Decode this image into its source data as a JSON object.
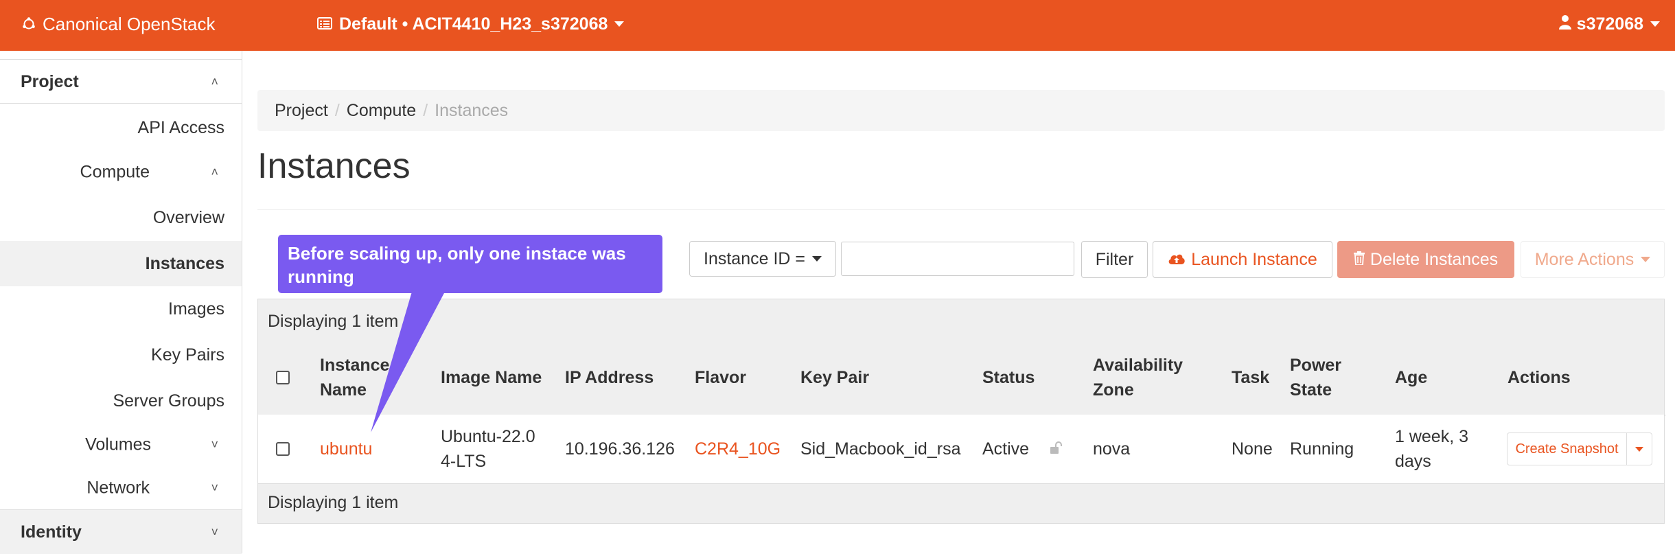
{
  "header": {
    "brand": "Canonical OpenStack",
    "project_selector": "Default • ACIT4410_H23_s372068",
    "user": "s372068",
    "accent": "#E95420"
  },
  "sidebar": {
    "project": "Project",
    "api_access": "API Access",
    "compute": "Compute",
    "overview": "Overview",
    "instances": "Instances",
    "images": "Images",
    "key_pairs": "Key Pairs",
    "server_groups": "Server Groups",
    "volumes": "Volumes",
    "network": "Network",
    "identity": "Identity"
  },
  "breadcrumb": [
    "Project",
    "Compute",
    "Instances"
  ],
  "page_title": "Instances",
  "toolbar": {
    "filter_field": "Instance ID =",
    "filter_value": "",
    "filter_button": "Filter",
    "launch_button": "Launch Instance",
    "delete_button": "Delete Instances",
    "more_button": "More Actions"
  },
  "table": {
    "display_count_text": "Displaying 1 item",
    "columns": {
      "instance_name": "Instance Name",
      "image_name": "Image Name",
      "ip_address": "IP Address",
      "flavor": "Flavor",
      "key_pair": "Key Pair",
      "status": "Status",
      "availability_zone": "Availability Zone",
      "task": "Task",
      "power_state": "Power State",
      "age": "Age",
      "actions": "Actions"
    },
    "rows": [
      {
        "instance_name": "ubuntu",
        "image_name": "Ubuntu-22.0 4-LTS",
        "ip_address": "10.196.36.126",
        "flavor": "C2R4_10G",
        "key_pair": "Sid_Macbook_id_rsa",
        "status": "Active",
        "availability_zone": "nova",
        "task": "None",
        "power_state": "Running",
        "age": "1 week, 3 days",
        "action": "Create Snapshot"
      }
    ]
  },
  "annotation": {
    "text": "Before scaling up, only one instace was running",
    "color": "#7A5AF0"
  }
}
